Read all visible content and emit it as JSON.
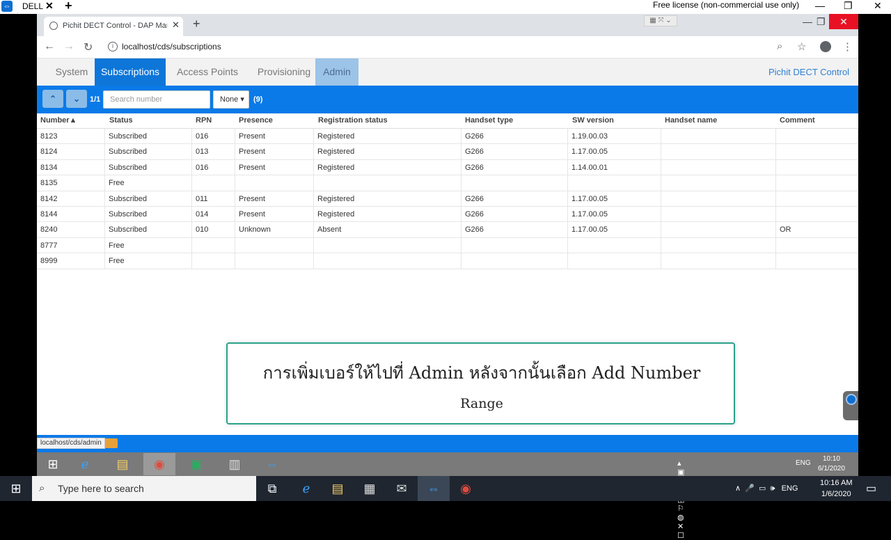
{
  "outer": {
    "tab_label": "DELL",
    "close": "✕",
    "add": "+",
    "license": "Free license (non-commercial use only)",
    "minimize": "—",
    "restore": "❐",
    "close_window": "✕"
  },
  "browser": {
    "tab_title": "Pichit DECT Control - DAP Manag",
    "tab_close": "✕",
    "new_tab": "+",
    "url": "localhost/cds/subscriptions",
    "minimize": "—",
    "restore": "❐",
    "close": "✕"
  },
  "nav": {
    "tabs": [
      {
        "label": "System",
        "state": "normal"
      },
      {
        "label": "Subscriptions",
        "state": "active"
      },
      {
        "label": "Access Points",
        "state": "normal"
      },
      {
        "label": "Provisioning",
        "state": "normal"
      },
      {
        "label": "Admin",
        "state": "hover"
      }
    ],
    "brand": "Pichit DECT Control"
  },
  "toolbar": {
    "up": "⌃",
    "down": "⌄",
    "page_info": "1/1",
    "search_placeholder": "Search number",
    "filter_label": "None ▾",
    "count": "(9)"
  },
  "table": {
    "columns": [
      "Number▲",
      "Status",
      "RPN",
      "Presence",
      "Registration status",
      "Handset type",
      "SW version",
      "Handset name",
      "Comment"
    ],
    "rows": [
      [
        "8123",
        "Subscribed",
        "016",
        "Present",
        "Registered",
        "G266",
        "1.19.00.03",
        "",
        ""
      ],
      [
        "8124",
        "Subscribed",
        "013",
        "Present",
        "Registered",
        "G266",
        "1.17.00.05",
        "",
        ""
      ],
      [
        "8134",
        "Subscribed",
        "016",
        "Present",
        "Registered",
        "G266",
        "1.14.00.01",
        "",
        ""
      ],
      [
        "8135",
        "Free",
        "",
        "",
        "",
        "",
        "",
        "",
        ""
      ],
      [
        "8142",
        "Subscribed",
        "011",
        "Present",
        "Registered",
        "G266",
        "1.17.00.05",
        "",
        ""
      ],
      [
        "8144",
        "Subscribed",
        "014",
        "Present",
        "Registered",
        "G266",
        "1.17.00.05",
        "",
        ""
      ],
      [
        "8240",
        "Subscribed",
        "010",
        "Unknown",
        "Absent",
        "G266",
        "1.17.00.05",
        "",
        "OR"
      ],
      [
        "8777",
        "Free",
        "",
        "",
        "",
        "",
        "",
        "",
        ""
      ],
      [
        "8999",
        "Free",
        "",
        "",
        "",
        "",
        "",
        "",
        ""
      ]
    ]
  },
  "caption": {
    "line1": "การเพิ่มเบอร์ให้ไปที่ Admin หลังจากนั้นเลือก Add Number",
    "line2": "Range"
  },
  "status_url": "localhost/cds/admin",
  "remote_taskbar": {
    "tray_lang": "ENG",
    "time": "10:10",
    "date": "6/1/2020"
  },
  "taskbar": {
    "search_placeholder": "Type here to search",
    "lang": "ENG",
    "time": "10:16 AM",
    "date": "1/6/2020"
  },
  "colors": {
    "primary_blue": "#0a7ae8",
    "active_tab": "#0d76d8",
    "caption_border": "#2aa28a",
    "close_red": "#e81123"
  }
}
